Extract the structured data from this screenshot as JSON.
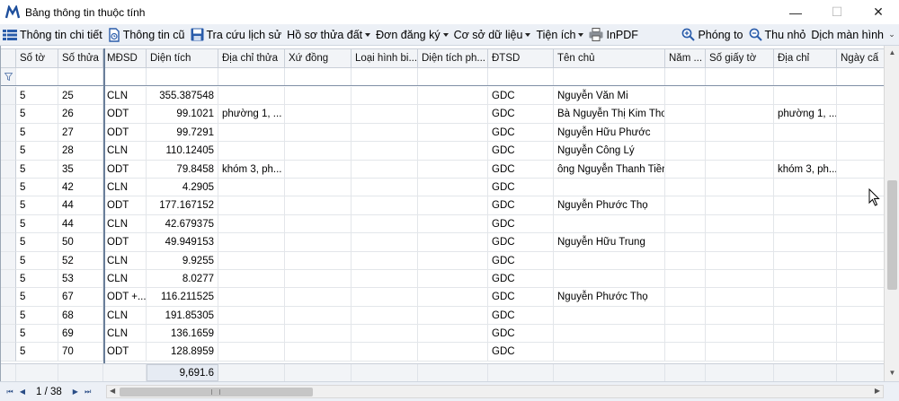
{
  "window": {
    "title": "Bảng thông tin thuộc tính",
    "minimize": "—",
    "maximize": "☐",
    "close": "✕"
  },
  "toolbar": {
    "items": [
      {
        "label": "Thông tin chi tiết",
        "icon": "grid-list-icon",
        "dropdown": false
      },
      {
        "label": "Thông tin cũ",
        "icon": "document-history-icon",
        "dropdown": false
      },
      {
        "label": "Tra cứu lịch sử",
        "icon": "save-disk-icon",
        "dropdown": false
      },
      {
        "label": "Hồ sơ thửa đất",
        "icon": "",
        "dropdown": true
      },
      {
        "label": "Đơn đăng ký",
        "icon": "",
        "dropdown": true
      },
      {
        "label": "Cơ sở dữ liệu",
        "icon": "",
        "dropdown": true
      },
      {
        "label": "Tiện ích",
        "icon": "",
        "dropdown": true
      },
      {
        "label": "InPDF",
        "icon": "printer-icon",
        "dropdown": false
      }
    ],
    "right_items": [
      {
        "label": "Phóng to",
        "icon": "zoom-in-icon"
      },
      {
        "label": "Thu nhỏ",
        "icon": "zoom-out-icon"
      },
      {
        "label": "Dịch màn hình",
        "icon": ""
      }
    ],
    "overflow": "⌄"
  },
  "grid": {
    "columns": [
      "Số tờ",
      "Số thửa",
      "MĐSD",
      "Diện tích",
      "Địa chỉ thửa",
      "Xứ đồng",
      "Loại hình bi...",
      "Diện tích ph...",
      "ĐTSD",
      "Tên chủ",
      "Năm ...",
      "Số giấy tờ",
      "Địa chỉ",
      "Ngày cấ"
    ],
    "rows": [
      [
        "5",
        "25",
        "CLN",
        "355.387548",
        "",
        "",
        "",
        "",
        "GDC",
        "Nguyễn Văn Mi",
        "",
        "",
        "",
        ""
      ],
      [
        "5",
        "26",
        "ODT",
        "99.1021",
        "phường 1, ...",
        "",
        "",
        "",
        "GDC",
        "Bà Nguyễn Thị Kim Thoa",
        "",
        "",
        "phường 1, ...",
        ""
      ],
      [
        "5",
        "27",
        "ODT",
        "99.7291",
        "",
        "",
        "",
        "",
        "GDC",
        "Nguyễn Hữu Phước",
        "",
        "",
        "",
        ""
      ],
      [
        "5",
        "28",
        "CLN",
        "110.12405",
        "",
        "",
        "",
        "",
        "GDC",
        "Nguyễn Công Lý",
        "",
        "",
        "",
        ""
      ],
      [
        "5",
        "35",
        "ODT",
        "79.8458",
        "khóm 3, ph...",
        "",
        "",
        "",
        "GDC",
        "ông Nguyễn Thanh Tiền",
        "",
        "",
        "khóm 3, ph...",
        ""
      ],
      [
        "5",
        "42",
        "CLN",
        "4.2905",
        "",
        "",
        "",
        "",
        "GDC",
        "",
        "",
        "",
        "",
        ""
      ],
      [
        "5",
        "44",
        "ODT",
        "177.167152",
        "",
        "",
        "",
        "",
        "GDC",
        "Nguyễn Phước Thọ",
        "",
        "",
        "",
        ""
      ],
      [
        "5",
        "44",
        "CLN",
        "42.679375",
        "",
        "",
        "",
        "",
        "GDC",
        "",
        "",
        "",
        "",
        ""
      ],
      [
        "5",
        "50",
        "ODT",
        "49.949153",
        "",
        "",
        "",
        "",
        "GDC",
        "Nguyễn Hữu Trung",
        "",
        "",
        "",
        ""
      ],
      [
        "5",
        "52",
        "CLN",
        "9.9255",
        "",
        "",
        "",
        "",
        "GDC",
        "",
        "",
        "",
        "",
        ""
      ],
      [
        "5",
        "53",
        "CLN",
        "8.0277",
        "",
        "",
        "",
        "",
        "GDC",
        "",
        "",
        "",
        "",
        ""
      ],
      [
        "5",
        "67",
        "ODT +...",
        "116.211525",
        "",
        "",
        "",
        "",
        "GDC",
        "Nguyễn Phước Thọ",
        "",
        "",
        "",
        ""
      ],
      [
        "5",
        "68",
        "CLN",
        "191.85305",
        "",
        "",
        "",
        "",
        "GDC",
        "",
        "",
        "",
        "",
        ""
      ],
      [
        "5",
        "69",
        "CLN",
        "136.1659",
        "",
        "",
        "",
        "",
        "GDC",
        "",
        "",
        "",
        "",
        ""
      ],
      [
        "5",
        "70",
        "ODT",
        "128.8959",
        "",
        "",
        "",
        "",
        "GDC",
        "",
        "",
        "",
        "",
        ""
      ]
    ],
    "total_area": "9,691.6"
  },
  "navigator": {
    "first": "⏮",
    "prev": "◀",
    "page": "1 / 38",
    "next": "▶",
    "last": "⏭"
  },
  "colors": {
    "toolbar_bg": "#ecf0f6",
    "header_bg": "#f2f4f7",
    "accent_blue": "#2a5caa"
  }
}
